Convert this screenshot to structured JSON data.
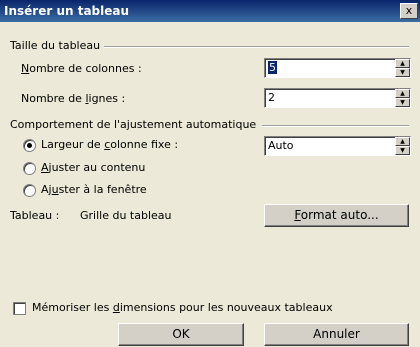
{
  "title": "Insérer un tableau",
  "close_glyph": "x",
  "group_size": {
    "label": "Taille du tableau"
  },
  "columns": {
    "label_pre": "",
    "label_u": "N",
    "label_post": "ombre de colonnes :",
    "value": "5"
  },
  "rows": {
    "label_pre": "Nombre de ",
    "label_u": "l",
    "label_post": "ignes :",
    "value": "2"
  },
  "group_autofit": {
    "label": "Comportement de l'ajustement automatique"
  },
  "fixed_width": {
    "label_pre": "Largeur de ",
    "label_u": "c",
    "label_post": "olonne fixe :",
    "value": "Auto",
    "selected": true
  },
  "fit_content": {
    "label_pre": "",
    "label_u": "A",
    "label_post": "juster au contenu"
  },
  "fit_window": {
    "label_pre": "Aj",
    "label_u": "u",
    "label_post": "ster à la fenêtre"
  },
  "table_style": {
    "label": "Tableau :",
    "value": "Grille du tableau"
  },
  "autoformat_button": {
    "label_pre": "",
    "label_u": "F",
    "label_post": "ormat auto..."
  },
  "remember": {
    "label_pre": "Mémoriser les ",
    "label_u": "d",
    "label_post": "imensions pour les nouveaux tableaux",
    "checked": false
  },
  "ok_button": "OK",
  "cancel_button": "Annuler"
}
